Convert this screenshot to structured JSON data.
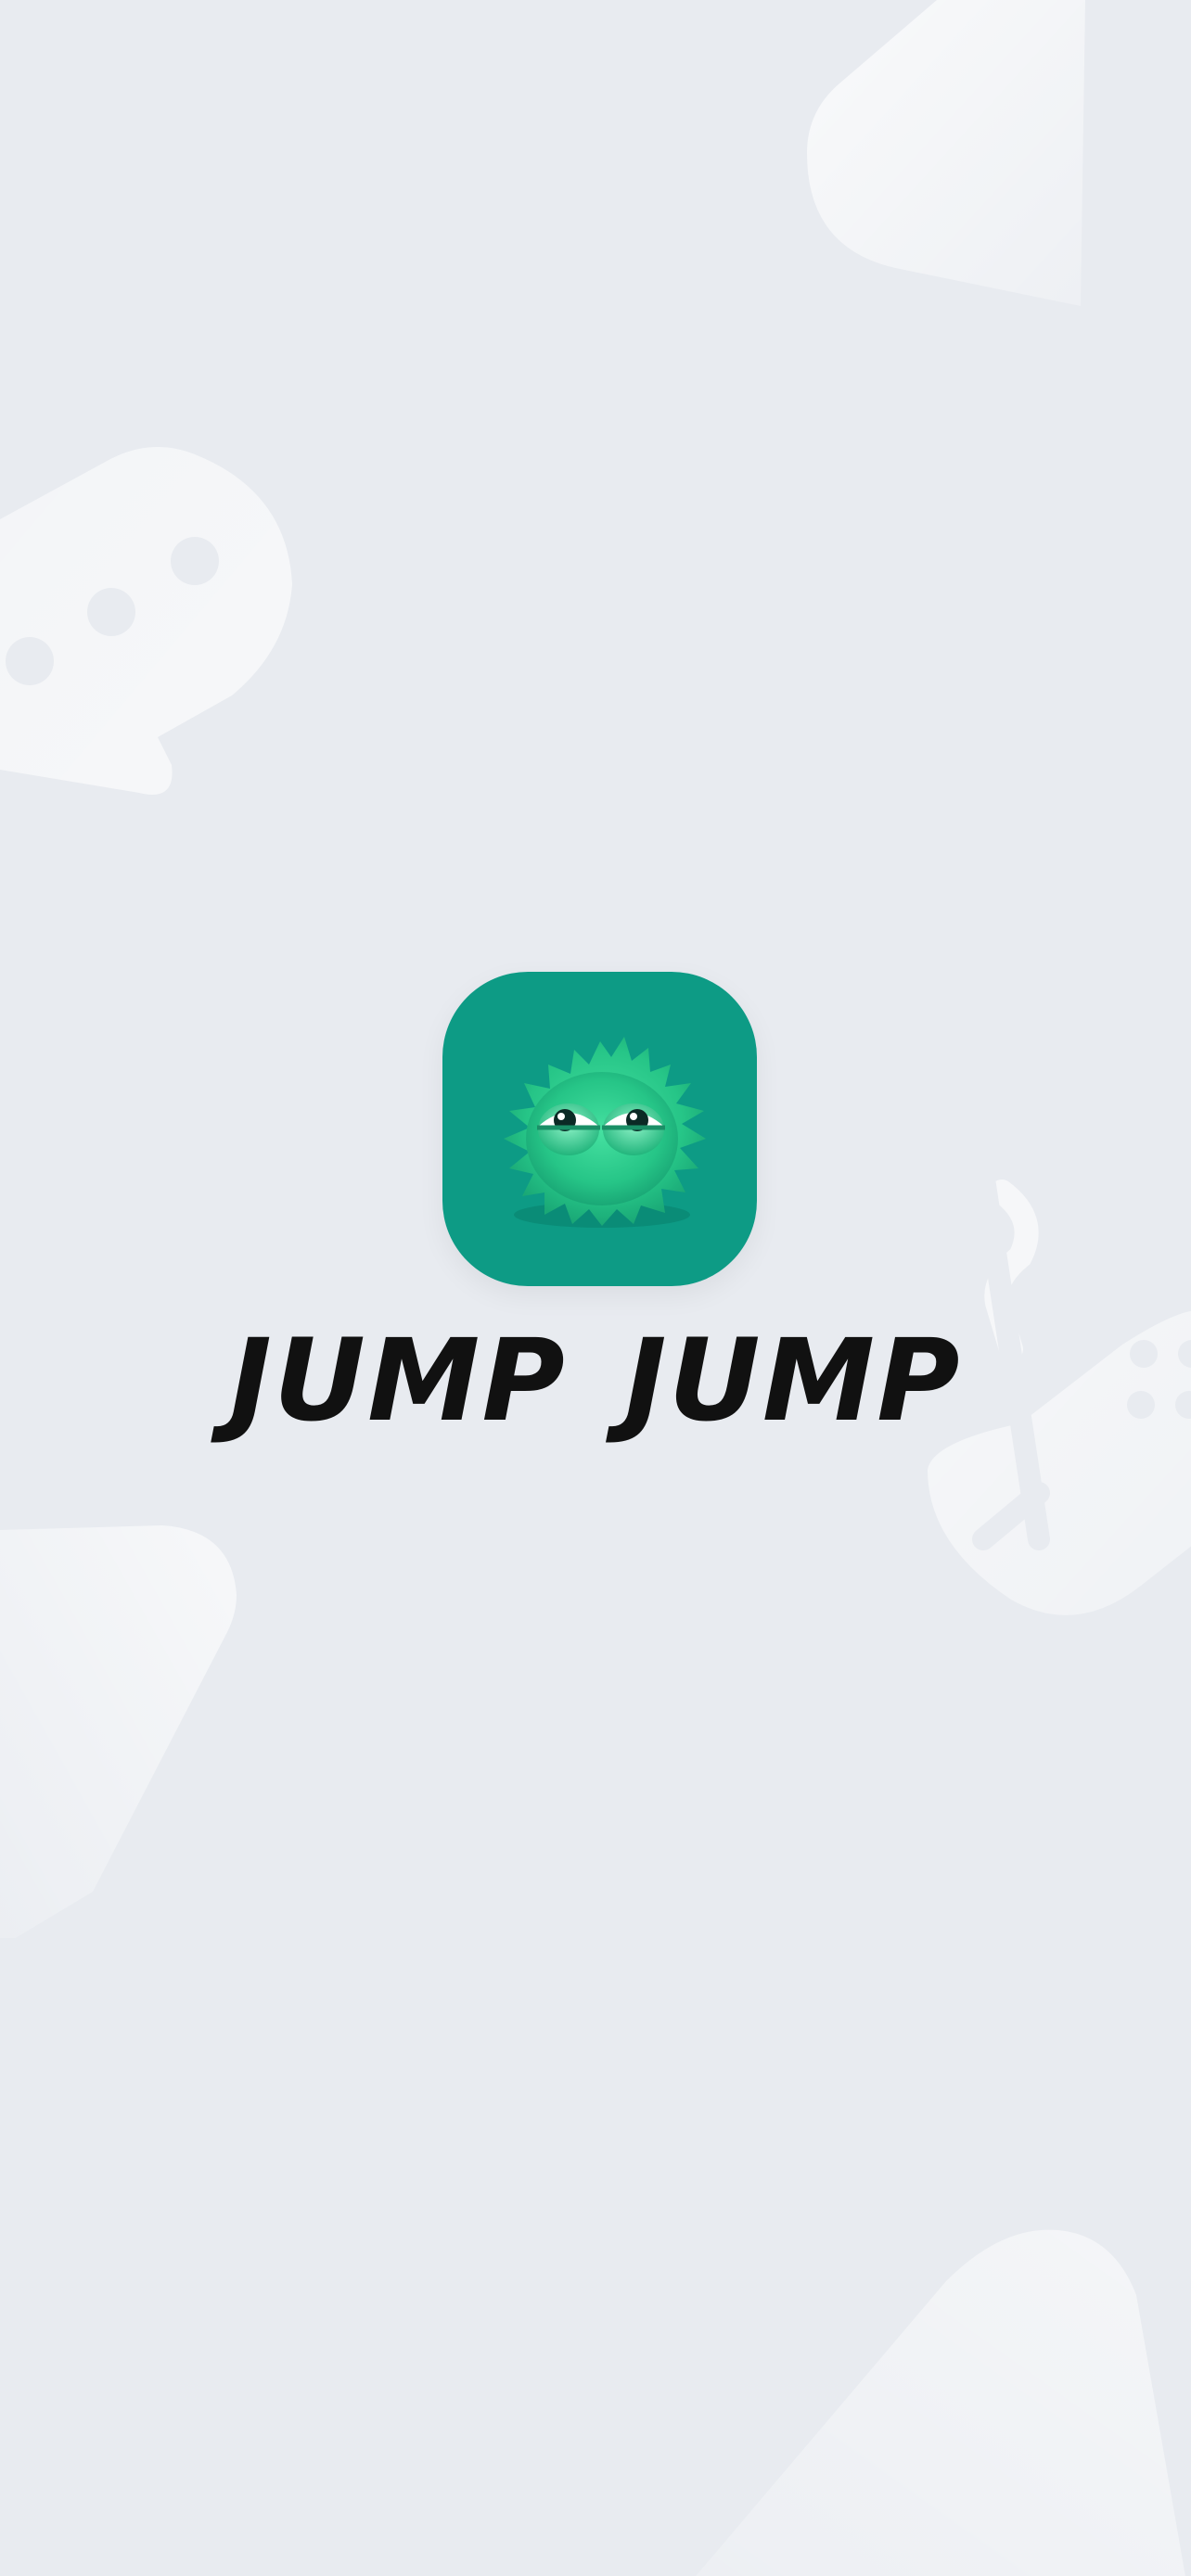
{
  "app": {
    "title": "JUMP JUMP",
    "logo_icon": "fluffy-green-monster-icon"
  },
  "colors": {
    "background": "#e8ebf0",
    "logo_bg": "#0d9b85",
    "monster": "#2ed08e",
    "title_text": "#111111"
  },
  "decorations": [
    "chat-bubble-icon",
    "chat-bubble-dots-icon",
    "game-controller-icon",
    "triangle-shape-icon"
  ]
}
